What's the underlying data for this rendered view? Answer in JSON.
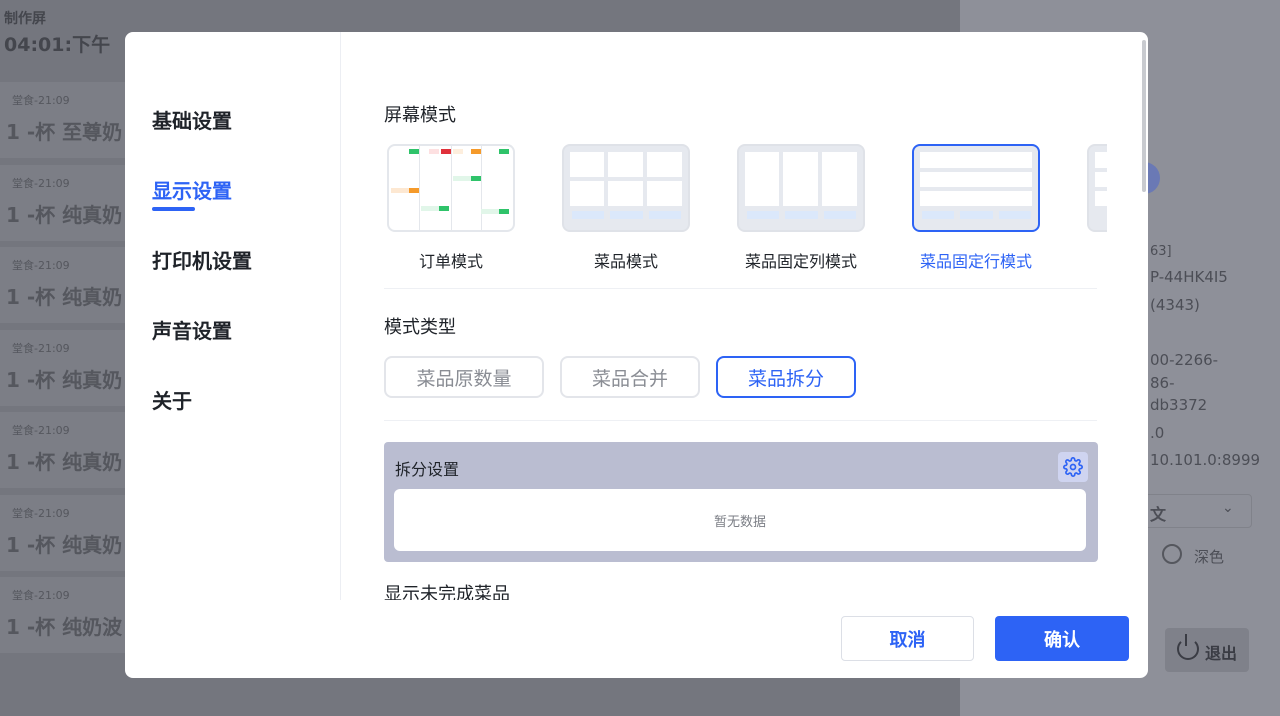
{
  "background": {
    "header_title": "制作屏",
    "header_time": "04:01:下午",
    "order_tag": "堂食-21:09",
    "order_items": [
      "1 -杯 至尊奶",
      "1 -杯 纯真奶",
      "1 -杯 纯真奶",
      "1 -杯 纯真奶",
      "1 -杯 纯真奶",
      "1 -杯 纯真奶",
      "1 -杯 纯奶波"
    ],
    "info_lines": [
      "63]",
      "P-44HK4I5",
      "(4343)",
      "00-2266-",
      "86-",
      "db3372",
      ".0",
      "10.101.0:8999"
    ],
    "language": "文",
    "theme_dark": "深色",
    "logout": "退出"
  },
  "sidebar": {
    "items": [
      {
        "label": "基础设置"
      },
      {
        "label": "显示设置"
      },
      {
        "label": "打印机设置"
      },
      {
        "label": "声音设置"
      },
      {
        "label": "关于"
      }
    ],
    "active": "显示设置"
  },
  "screen_mode": {
    "title": "屏幕模式",
    "options": [
      {
        "label": "订单模式"
      },
      {
        "label": "菜品模式"
      },
      {
        "label": "菜品固定列模式"
      },
      {
        "label": "菜品固定行模式"
      }
    ],
    "selected": "菜品固定行模式"
  },
  "mode_type": {
    "title": "模式类型",
    "options": [
      {
        "label": "菜品原数量"
      },
      {
        "label": "菜品合并"
      },
      {
        "label": "菜品拆分"
      }
    ],
    "selected": "菜品拆分"
  },
  "split_settings": {
    "title": "拆分设置",
    "empty_text": "暂无数据"
  },
  "next_section": {
    "title": "显示未完成菜品"
  },
  "footer": {
    "cancel_label": "取消",
    "confirm_label": "确认"
  },
  "colors": {
    "accent": "#2d63f5",
    "green": "#2fc36a",
    "red": "#e0313b",
    "orange": "#f59a2a"
  }
}
